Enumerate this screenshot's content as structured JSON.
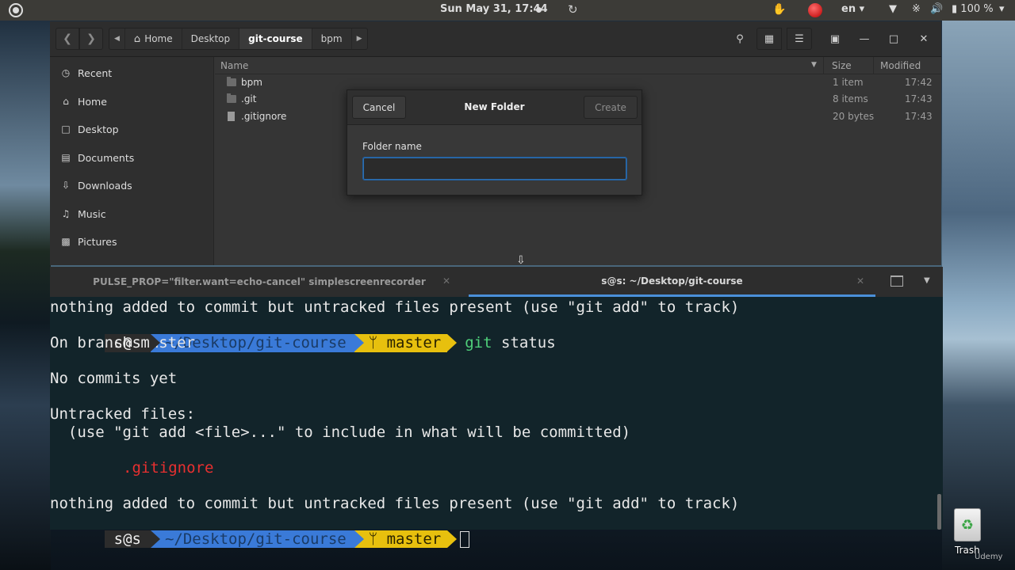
{
  "top_panel": {
    "clock": "Sun May 31, 17:44",
    "language": "en ▾",
    "battery": "100 %",
    "icons": [
      "activities-icon",
      "refresh-icon",
      "hand-icon",
      "record-icon",
      "wifi-icon",
      "bluetooth-icon",
      "volume-icon",
      "battery-icon",
      "power-icon"
    ]
  },
  "file_manager": {
    "breadcrumbs": [
      "Home",
      "Desktop",
      "git-course",
      "bpm"
    ],
    "active_crumb": "git-course",
    "sidebar": [
      {
        "label": "Recent",
        "icon": "clock-icon"
      },
      {
        "label": "Home",
        "icon": "home-icon"
      },
      {
        "label": "Desktop",
        "icon": "desktop-icon"
      },
      {
        "label": "Documents",
        "icon": "document-icon"
      },
      {
        "label": "Downloads",
        "icon": "download-icon"
      },
      {
        "label": "Music",
        "icon": "music-icon"
      },
      {
        "label": "Pictures",
        "icon": "picture-icon"
      }
    ],
    "columns": {
      "name": "Name",
      "size": "Size",
      "modified": "Modified"
    },
    "files": [
      {
        "name": "bpm",
        "size": "1 item",
        "modified": "17:42",
        "type": "folder"
      },
      {
        "name": ".git",
        "size": "8 items",
        "modified": "17:43",
        "type": "folder"
      },
      {
        "name": ".gitignore",
        "size": "20 bytes",
        "modified": "17:43",
        "type": "file"
      }
    ]
  },
  "dialog": {
    "title": "New Folder",
    "cancel_label": "Cancel",
    "create_label": "Create",
    "field_label": "Folder name",
    "field_value": ""
  },
  "terminal": {
    "tabs": [
      {
        "title": "PULSE_PROP=\"filter.want=echo-cancel\" simplescreenrecorder"
      },
      {
        "title": "s@s: ~/Desktop/git-course",
        "active": true
      }
    ],
    "prompt": {
      "user": "s@s",
      "path": "~/Desktop/git-course",
      "branch": "ᛘ master"
    },
    "lines": {
      "l1": "nothing added to commit but untracked files present (use \"git add\" to track)",
      "cmd_git": "git",
      "cmd_rest": " status",
      "l3": "On branch master",
      "l5": "No commits yet",
      "l7": "Untracked files:",
      "l8": "  (use \"git add <file>...\" to include in what will be committed)",
      "l10": ".gitignore",
      "l12": "nothing added to commit but untracked files present (use \"git add\" to track)"
    },
    "colors": {
      "path": "#3a7ad8",
      "branch": "#e7c00e",
      "untracked": "#e83030",
      "command": "#4fd07a"
    }
  },
  "desktop": {
    "trash_label": "Trash",
    "watermark": "Udemy"
  }
}
